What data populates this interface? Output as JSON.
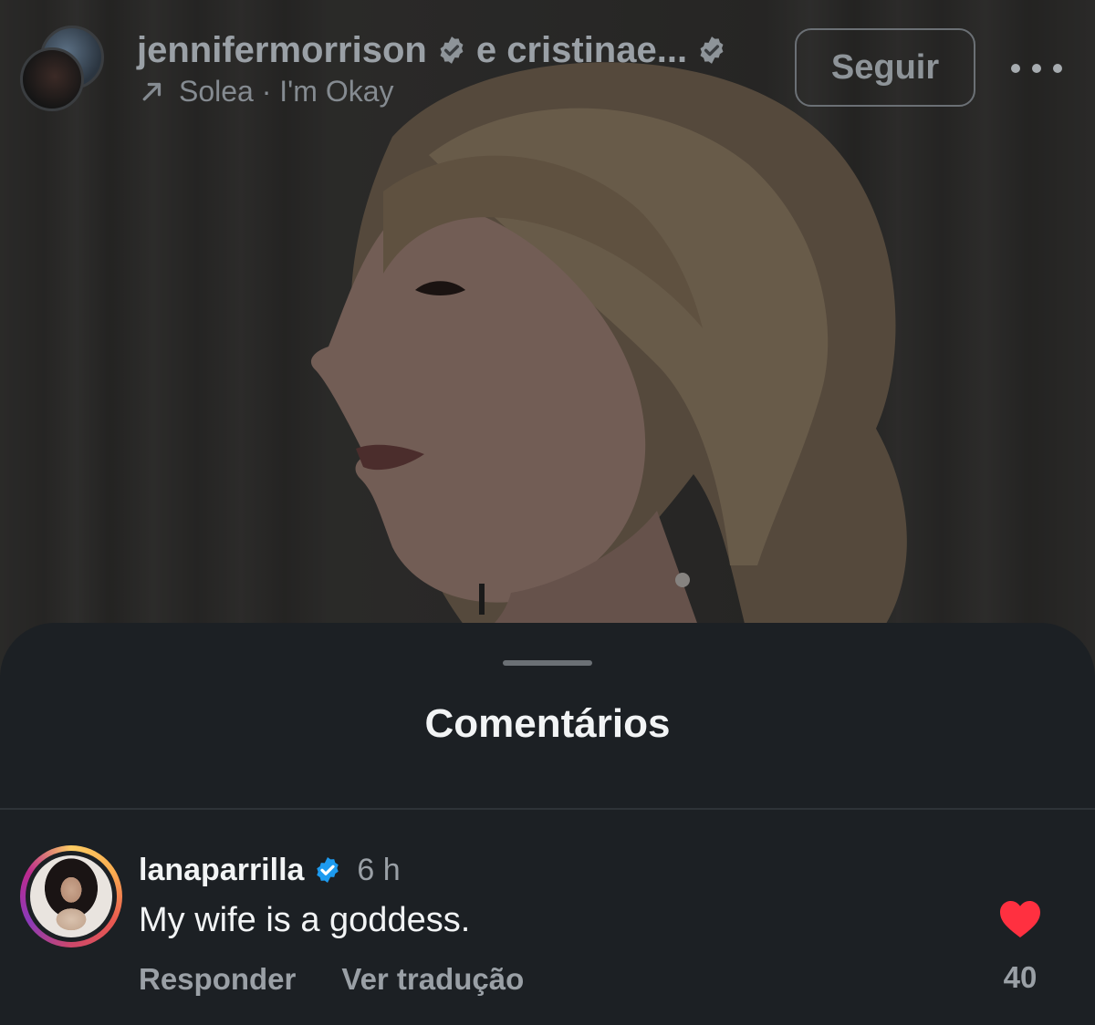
{
  "post_header": {
    "author": "jennifermorrison",
    "coauthor": "e cristinae...",
    "audio_track": "Solea · I'm Okay",
    "follow_label": "Seguir"
  },
  "comments_sheet": {
    "title": "Comentários",
    "comments": [
      {
        "username": "lanaparrilla",
        "time": "6 h",
        "text": "My wife is a goddess.",
        "reply_label": "Responder",
        "translate_label": "Ver tradução",
        "like_count": "40"
      }
    ]
  },
  "colors": {
    "sheet_background": "#1c2024",
    "verified_blue": "#1d9bf0",
    "like_red": "#ff3040"
  },
  "icons": {
    "verified": "verified-badge-icon",
    "audio": "arrow-up-right-icon",
    "more": "more-horizontal-icon",
    "like": "heart-filled-icon"
  }
}
